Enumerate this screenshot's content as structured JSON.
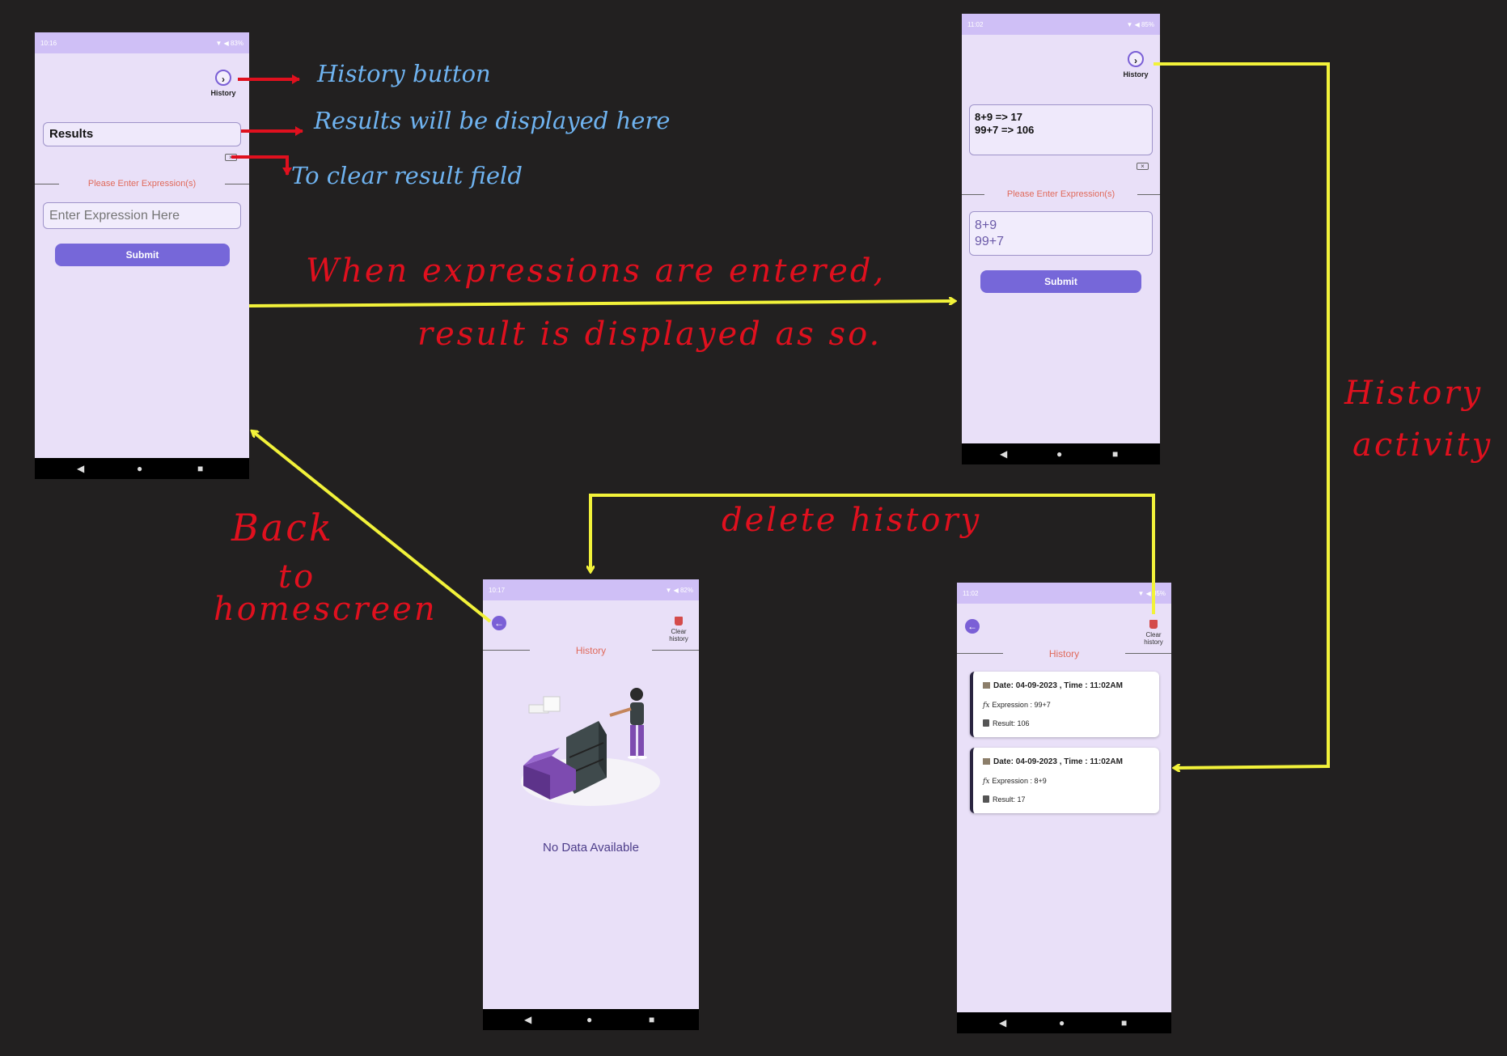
{
  "screen_main": {
    "status_time": "10:16",
    "status_right": "▼ ◀ 83%",
    "history_label": "History",
    "history_icon": "history-icon",
    "results_label": "Results",
    "prompt": "Please Enter Expression(s)",
    "input_placeholder": "Enter Expression Here",
    "submit_label": "Submit"
  },
  "screen_result": {
    "status_time": "11:02",
    "status_right": "▼ ◀ 85%",
    "history_label": "History",
    "results_lines": [
      "8+9 => 17",
      "99+7 => 106"
    ],
    "prompt": "Please Enter Expression(s)",
    "input_lines": [
      "8+9",
      "99+7"
    ],
    "submit_label": "Submit"
  },
  "screen_history_empty": {
    "status_time": "10:17",
    "status_right": "▼ ◀ 82%",
    "clear_label_1": "Clear",
    "clear_label_2": "history",
    "title": "History",
    "no_data": "No Data Available"
  },
  "screen_history_list": {
    "status_time": "11:02",
    "status_right": "▼ ◀ 85%",
    "clear_label_1": "Clear",
    "clear_label_2": "history",
    "title": "History",
    "entries": [
      {
        "date": "Date: 04-09-2023 , Time : 11:02AM",
        "expression": "Expression : 99+7",
        "result": "Result: 106"
      },
      {
        "date": "Date: 04-09-2023 , Time : 11:02AM",
        "expression": "Expression : 8+9",
        "result": "Result: 17"
      }
    ]
  },
  "nav_icons": [
    "back-triangle-icon",
    "home-circle-icon",
    "recents-square-icon"
  ],
  "annotations": {
    "history_button": "History button",
    "results_here": "Results will be displayed here",
    "clear_field": "To clear result field",
    "when_line1": "When expressions are entered,",
    "when_line2": "result is displayed as so.",
    "history_activity_1": "History",
    "history_activity_2": "activity",
    "delete_history": "delete history",
    "back_1": "Back",
    "back_2": "to",
    "back_3": "homescreen"
  },
  "colors": {
    "background": "#222020",
    "phone_bg": "#e9e0f8",
    "statusbar": "#cfbff6",
    "accent": "#7667d9",
    "prompt_text": "#e06a5b",
    "annotation_blue": "#6fb3f0",
    "annotation_red": "#e0101e",
    "arrow_yellow": "#f2f23a"
  }
}
